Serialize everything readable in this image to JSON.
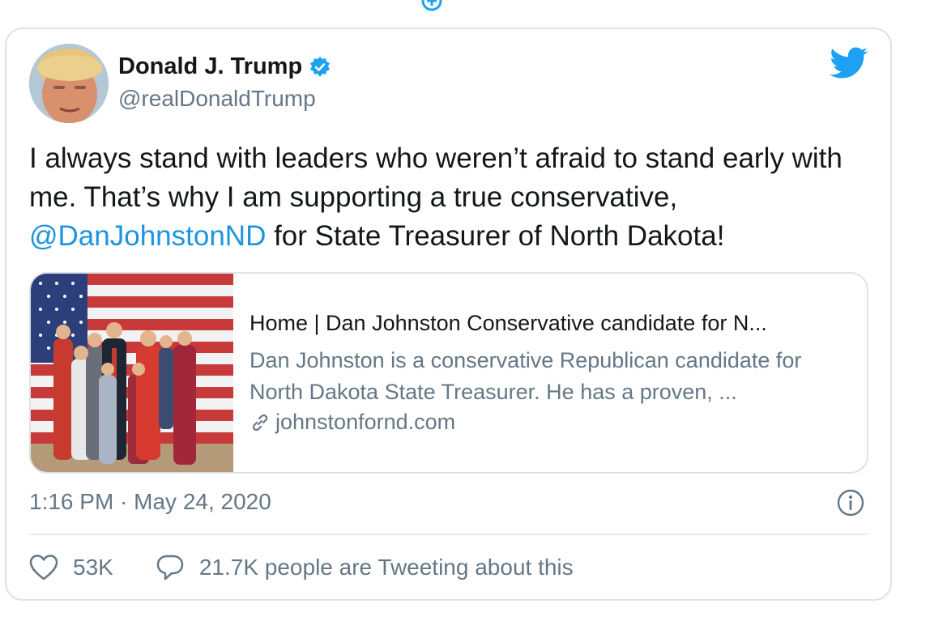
{
  "tweet": {
    "display_name": "Donald J. Trump",
    "handle": "@realDonaldTrump",
    "text_part1": "I always stand with leaders who weren’t afraid to stand early with me. That’s why I am supporting a true conservative, ",
    "mention": "@DanJohnstonND",
    "text_part2": " for State Treasurer of North Dakota!",
    "timestamp": "1:16 PM · May 24, 2020"
  },
  "link_card": {
    "title": "Home | Dan Johnston Conservative candidate for N...",
    "description": "Dan Johnston is a conservative Republican candidate for North Dakota State Treasurer. He has a proven, ...",
    "domain": "johnstonfornd.com"
  },
  "actions": {
    "likes": "53K",
    "tweeting": "21.7K people are Tweeting about this"
  },
  "colors": {
    "accent": "#1da1f2",
    "link": "#1b95e0",
    "muted": "#657786",
    "border": "#dde2e6"
  },
  "icons": [
    "plus-circle-icon",
    "verified-badge-icon",
    "twitter-bird-icon",
    "link-icon",
    "info-icon",
    "heart-icon",
    "reply-icon"
  ]
}
